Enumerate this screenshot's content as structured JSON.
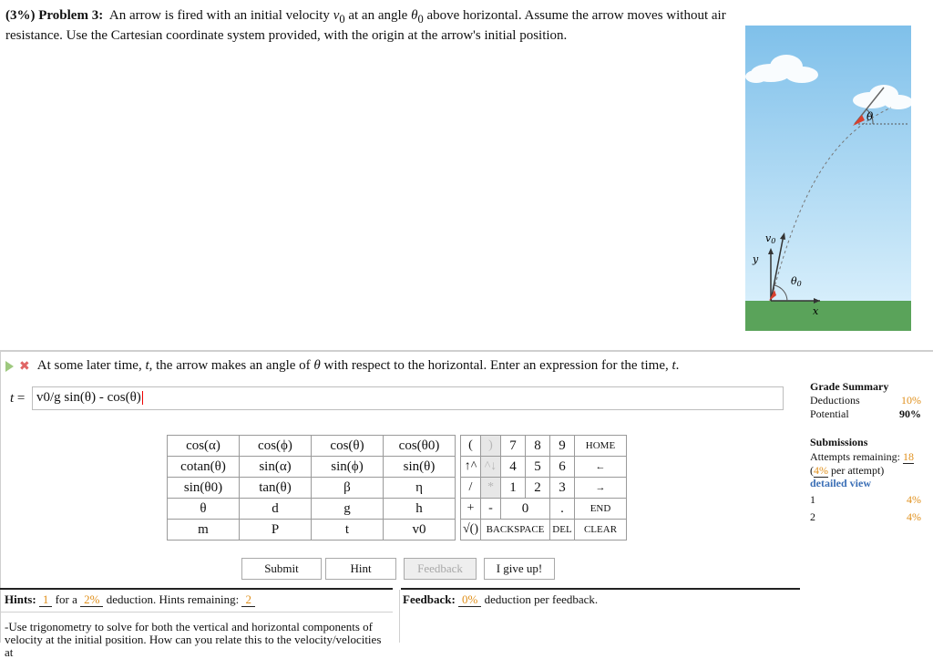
{
  "problem": {
    "percent": "(3%)",
    "number": "Problem 3:",
    "text_parts": [
      "An arrow is fired with an initial velocity ",
      "v",
      "0",
      " at an angle ",
      "θ",
      "0",
      " above horizontal. Assume the arrow moves without air resistance. Use the Cartesian coordinate system provided, with the origin at the arrow's initial position."
    ]
  },
  "figure": {
    "labels": {
      "theta": "θ",
      "v0": "v",
      "v0_sub": "0",
      "theta0": "θ",
      "theta0_sub": "0",
      "y": "y",
      "x": "x"
    },
    "colors": {
      "sky": "#a8d6f0",
      "ground": "#5aa35a",
      "arrow_tip": "#d8412f"
    }
  },
  "question": {
    "text_parts": [
      "At some later time, ",
      "t",
      ", the arrow makes an angle of ",
      "θ",
      " with respect to the horizontal. Enter an expression for the time, ",
      "t",
      "."
    ]
  },
  "answer": {
    "label_var": "t",
    "label_eq": " =",
    "value": "v0/g sin(θ) - cos(θ)"
  },
  "keypad": {
    "functions": [
      [
        "cos(α)",
        "cos(ϕ)",
        "cos(θ)",
        "cos(θ0)"
      ],
      [
        "cotan(θ)",
        "sin(α)",
        "sin(ϕ)",
        "sin(θ)"
      ],
      [
        "sin(θ0)",
        "tan(θ)",
        "β",
        "η"
      ],
      [
        "θ",
        "d",
        "g",
        "h"
      ],
      [
        "m",
        "P",
        "t",
        "v0"
      ]
    ],
    "ops": [
      [
        "(",
        ")"
      ],
      [
        "↑^",
        "^↓"
      ],
      [
        "/",
        "*"
      ],
      [
        "+",
        "-"
      ]
    ],
    "sqrt": "√()",
    "digits": [
      [
        "7",
        "8",
        "9"
      ],
      [
        "4",
        "5",
        "6"
      ],
      [
        "1",
        "2",
        "3"
      ]
    ],
    "zero": "0",
    "dot": ".",
    "commands": [
      "HOME",
      "←",
      "→",
      "END",
      "CLEAR"
    ],
    "backspace": "BACKSPACE",
    "del": "DEL"
  },
  "buttons": {
    "submit": "Submit",
    "hint": "Hint",
    "feedback": "Feedback",
    "give_up": "I give up!"
  },
  "hints": {
    "label": "Hints:",
    "count": "1",
    "for_a": "for a",
    "pct": "2%",
    "deduction_text": "deduction. Hints remaining:",
    "remaining": "2",
    "body": "-Use trigonometry to solve for both the vertical and horizontal components of velocity at the initial position. How can you relate this to the velocity/velocities at"
  },
  "feedback": {
    "label": "Feedback:",
    "pct": "0%",
    "text": "deduction per feedback."
  },
  "grade_summary": {
    "title": "Grade Summary",
    "deductions_label": "Deductions",
    "deductions_value": "10%",
    "potential_label": "Potential",
    "potential_value": "90%"
  },
  "submissions": {
    "title": "Submissions",
    "attempts_label": "Attempts remaining:",
    "attempts_value": "18",
    "per_attempt_pct": "4%",
    "per_attempt_text": "per attempt)",
    "detailed_view": "detailed view",
    "rows": [
      {
        "n": "1",
        "pct": "4%"
      },
      {
        "n": "2",
        "pct": "4%"
      }
    ]
  }
}
